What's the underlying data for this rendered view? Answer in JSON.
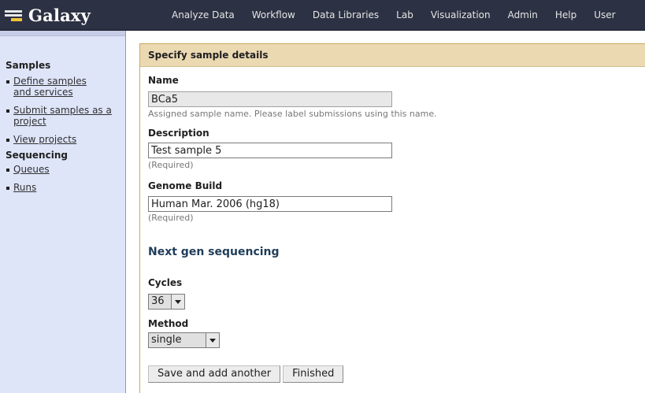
{
  "masthead": {
    "brand": "Galaxy",
    "nav": [
      "Analyze Data",
      "Workflow",
      "Data Libraries",
      "Lab",
      "Visualization",
      "Admin",
      "Help",
      "User"
    ]
  },
  "left_panel": {
    "samples_title": "Samples",
    "samples_items": [
      "Define samples and services",
      "Submit samples as a project",
      "View projects"
    ],
    "sequencing_title": "Sequencing",
    "sequencing_items": [
      "Queues",
      "Runs"
    ]
  },
  "form": {
    "header": "Specify sample details",
    "name": {
      "label": "Name",
      "value": "BCa5",
      "help": "Assigned sample name. Please label submissions using this name."
    },
    "description": {
      "label": "Description",
      "value": "Test sample 5",
      "help": "(Required)"
    },
    "genome_build": {
      "label": "Genome Build",
      "value": "Human Mar. 2006 (hg18)",
      "help": "(Required)"
    },
    "subheading": "Next gen sequencing",
    "cycles": {
      "label": "Cycles",
      "selected": "36"
    },
    "method": {
      "label": "Method",
      "selected": "single"
    },
    "buttons": {
      "save_another": "Save and add another",
      "finished": "Finished"
    }
  },
  "colors": {
    "masthead": "#2c3143",
    "left_panel": "#dfe5f9",
    "form_header": "#ebd9b2",
    "accent_border": "#c9a95e",
    "subheading": "#1f3c5a"
  }
}
